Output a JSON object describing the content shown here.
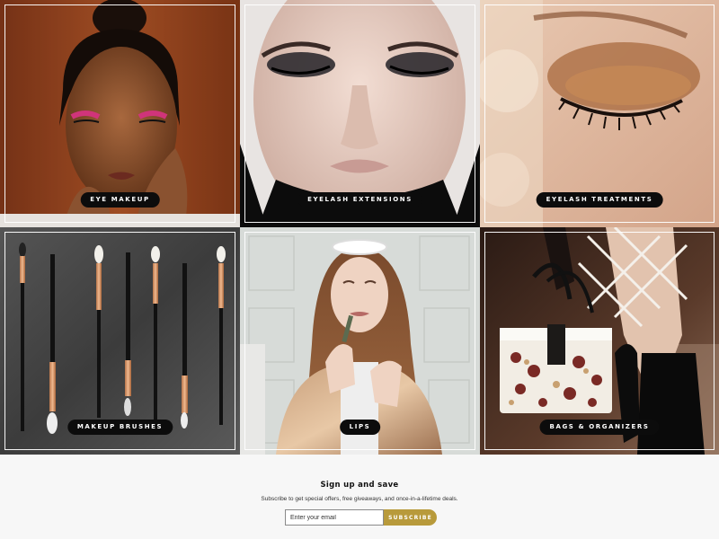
{
  "categories": [
    {
      "label": "EYE MAKEUP"
    },
    {
      "label": "EYELASH EXTENSIONS"
    },
    {
      "label": "EYELASH TREATMENTS"
    },
    {
      "label": "MAKEUP BRUSHES"
    },
    {
      "label": "LIPS"
    },
    {
      "label": "BAGS & ORGANIZERS"
    }
  ],
  "signup": {
    "title": "Sign up and save",
    "subtitle": "Subscribe to get special offers, free giveaways, and once-in-a-lifetime deals.",
    "email_placeholder": "Enter your email",
    "button_label": "SUBSCRIBE"
  },
  "colors": {
    "accent": "#b89a3b",
    "pill_bg": "#0c0c0c",
    "page_bg": "#f7f7f7"
  }
}
